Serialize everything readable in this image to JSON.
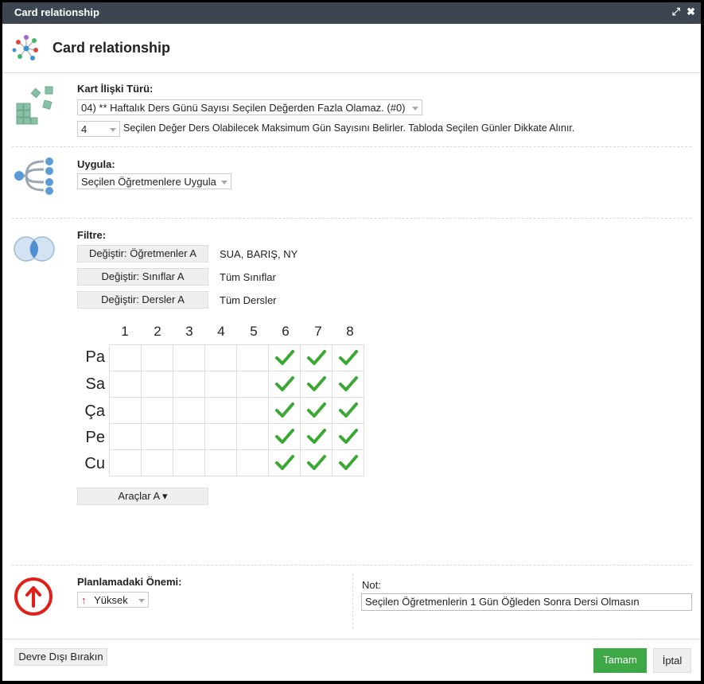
{
  "window": {
    "title": "Card relationship"
  },
  "header": {
    "title": "Card relationship"
  },
  "relationship": {
    "label": "Kart İlişki Türü:",
    "type_value": "04) ** Haftalık Ders Günü Sayısı Seçilen Değerden Fazla Olamaz. (#0)",
    "count_value": "4",
    "description": "Seçilen Değer Ders Olabilecek Maksimum Gün Sayısını Belirler. Tabloda Seçilen Günler Dikkate Alınır."
  },
  "apply": {
    "label": "Uygula:",
    "value": "Seçilen Öğretmenlere Uygula"
  },
  "filter": {
    "label": "Filtre:",
    "rows": [
      {
        "button": "Değiştir: Öğretmenler A",
        "value": "SUA, BARIŞ, NY"
      },
      {
        "button": "Değiştir: Sınıflar A",
        "value": "Tüm Sınıflar"
      },
      {
        "button": "Değiştir: Dersler A",
        "value": "Tüm Dersler"
      }
    ]
  },
  "grid": {
    "columns": [
      "1",
      "2",
      "3",
      "4",
      "5",
      "6",
      "7",
      "8"
    ],
    "rows": [
      "Pa",
      "Sa",
      "Ça",
      "Pe",
      "Cu"
    ],
    "checked": [
      [
        false,
        false,
        false,
        false,
        false,
        true,
        true,
        true
      ],
      [
        false,
        false,
        false,
        false,
        false,
        true,
        true,
        true
      ],
      [
        false,
        false,
        false,
        false,
        false,
        true,
        true,
        true
      ],
      [
        false,
        false,
        false,
        false,
        false,
        true,
        true,
        true
      ],
      [
        false,
        false,
        false,
        false,
        false,
        true,
        true,
        true
      ]
    ],
    "check_color": "#3aa832"
  },
  "tools": {
    "label": "Araçlar A ▾"
  },
  "importance": {
    "label": "Planlamadaki Önemi:",
    "value": "Yüksek",
    "color": "#e0201b"
  },
  "note": {
    "label": "Not:",
    "value": "Seçilen Öğretmenlerin 1 Gün Öğleden Sonra Dersi Olmasın"
  },
  "footer": {
    "disable_label": "Devre Dışı Bırakın",
    "ok_label": "Tamam",
    "cancel_label": "İptal",
    "ok_color": "#3fa846"
  }
}
